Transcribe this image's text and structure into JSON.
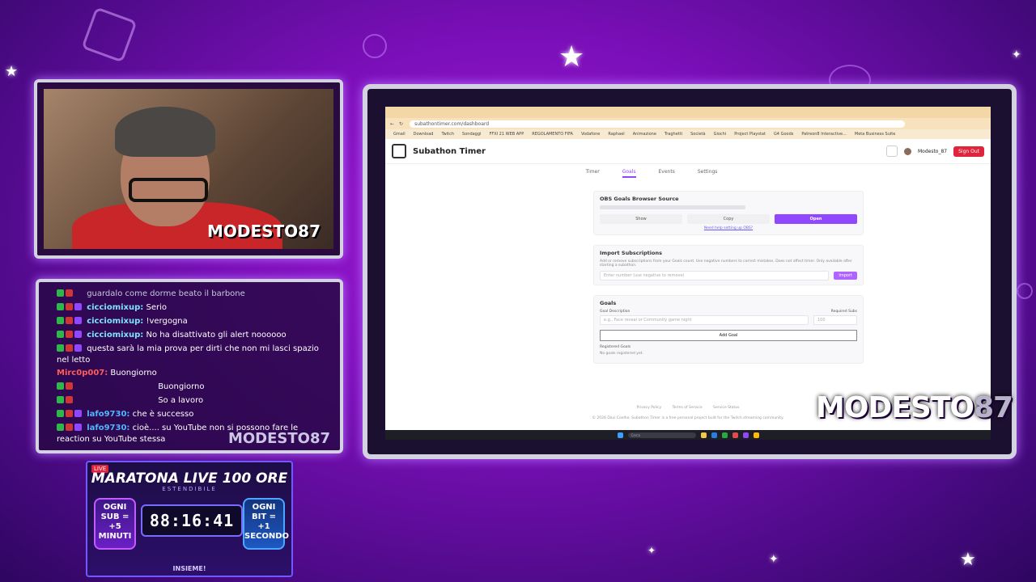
{
  "webcam": {
    "watermark": "MODESTO87"
  },
  "chat": {
    "watermark": "MODESTO87",
    "messages": [
      {
        "user": "",
        "text": "guardalo come dorme beato il barbone",
        "color": "#c7c7d9"
      },
      {
        "user": "cicciomixup:",
        "text": "Serio",
        "color": "#7ee3ff"
      },
      {
        "user": "cicciomixup:",
        "text": "!vergogna",
        "color": "#7ee3ff"
      },
      {
        "user": "cicciomixup:",
        "text": "No ha disattivato gli alert noooooo",
        "color": "#7ee3ff"
      },
      {
        "user": "",
        "text": "questa sarà la mia prova per dirti che non mi lasci spazio nel letto",
        "color": "#ffe066"
      },
      {
        "user": "Mirc0p007:",
        "text": "Buongiorno",
        "color": "#ff5c5c"
      },
      {
        "user": "",
        "text": "Buongiorno",
        "color": "#ff4040"
      },
      {
        "user": "",
        "text": "So a lavoro",
        "color": "#ff4040"
      },
      {
        "user": "lafo9730:",
        "text": "che è successo",
        "color": "#4fb7ff"
      },
      {
        "user": "lafo9730:",
        "text": "cioè.... su YouTube non si possono fare le reaction su YouTube stessa",
        "color": "#4fb7ff"
      }
    ]
  },
  "marathon": {
    "live_badge": "LIVE",
    "title": "MARATONA LIVE 100 ORE",
    "subtitle": "ESTENDIBILE",
    "timer": "88:16:41",
    "left_box": "OGNI SUB = +5 MINUTI",
    "right_box": "OGNI BIT = +1 SECONDO",
    "footer": "INSIEME!"
  },
  "browser": {
    "url": "subathontimer.com/dashboard",
    "bookmarks": [
      "Gmail",
      "Download",
      "Twitch",
      "Sondaggi",
      "FFXI 21 WEB APP",
      "REGOLAMENTO FIFA",
      "Vodafone",
      "Raphael",
      "Animazione",
      "Traghetti",
      "Società",
      "Giochi",
      "Project Playstat",
      "G4 Goods",
      "Patreon8 Interactive...",
      "Meta Business Suite"
    ]
  },
  "app": {
    "title": "Subathon Timer",
    "user": "Modesto_87",
    "sign_out": "Sign Out",
    "nav": {
      "timer": "Timer",
      "goals": "Goals",
      "events": "Events",
      "settings": "Settings"
    },
    "obs": {
      "heading": "OBS Goals Browser Source",
      "show": "Show",
      "copy": "Copy",
      "open": "Open",
      "help_link": "Need help setting up OBS?"
    },
    "import": {
      "heading": "Import Subscriptions",
      "description": "Add or remove subscriptions from your Goals count. Use negative numbers to correct mistakes. Does not affect timer. Only available after starting a subathon.",
      "placeholder": "Enter number (use negative to remove)",
      "button": "Import"
    },
    "goals": {
      "heading": "Goals",
      "desc_label": "Goal Description",
      "desc_placeholder": "e.g., Face reveal or Community game night",
      "subs_label": "Required Subs",
      "subs_placeholder": "100",
      "add_button": "Add Goal",
      "registered_label": "Registered Goals",
      "empty_text": "No goals registered yet."
    },
    "footer": {
      "privacy": "Privacy Policy",
      "terms": "Terms of Service",
      "status": "Service Status",
      "copyright": "© 2026 Davi Coelho. Subathon Timer is a free personal project built for the Twitch streaming community."
    },
    "taskbar_search": "Cerca"
  },
  "overlay": {
    "watermark_name": "MODESTO",
    "watermark_num": "87"
  }
}
